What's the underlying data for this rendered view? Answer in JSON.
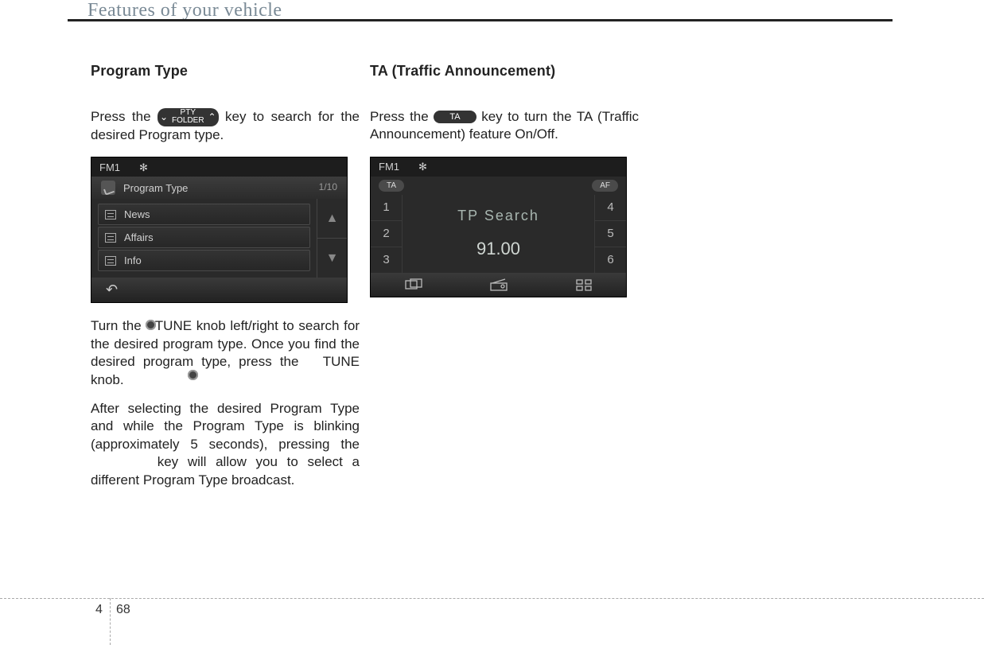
{
  "header": {
    "title": "Features of your vehicle"
  },
  "footer": {
    "chapter": "4",
    "page": "68"
  },
  "col1": {
    "heading": "Program Type",
    "p1a": "Press the ",
    "p1b": " key to search for the desired Program type.",
    "key_pty_top": "PTY",
    "key_pty_bottom": "FOLDER",
    "shot": {
      "band": "FM1",
      "bt": "✻",
      "subtitle": "Program Type",
      "count": "1/10",
      "items": [
        "News",
        "Affairs",
        "Info"
      ]
    },
    "p2": "Turn the   TUNE knob left/right to search for the desired program type. Once you find the desired program type, press the   TUNE knob.",
    "p3a": "After selecting the desired Program Type and while the Program Type is blinking (approximately 5 seconds), pressing the ",
    "p3b": " key will allow you to select a different Program Type broadcast."
  },
  "col2": {
    "heading": "TA (Traffic Announcement)",
    "p1a": "Press the ",
    "p1b": " key to turn the TA (Traffic Announcement) feature On/Off.",
    "key_ta": "TA",
    "shot": {
      "band": "FM1",
      "ta": "TA",
      "af": "AF",
      "presets_left": [
        "1",
        "2",
        "3"
      ],
      "presets_right": [
        "4",
        "5",
        "6"
      ],
      "line1": "TP Search",
      "freq": "91.00"
    }
  }
}
